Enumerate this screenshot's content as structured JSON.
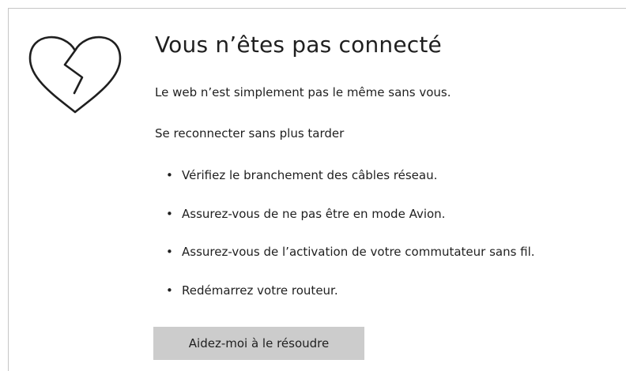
{
  "page": {
    "title": "Vous n’êtes pas connecté",
    "subtitle": "Le web n’est simplement pas le même sans vous.",
    "section_heading": "Se reconnecter sans plus tarder",
    "bullet_glyph": "•",
    "tips": [
      "Vérifiez le branchement des câbles réseau.",
      "Assurez-vous de ne pas être en mode Avion.",
      "Assurez-vous de l’activation de votre commutateur sans fil.",
      "Redémarrez votre routeur."
    ],
    "fix_button_label": "Aidez-moi à le résoudre"
  },
  "icons": {
    "status_icon": "broken-heart-icon"
  },
  "colors": {
    "text": "#1f1f1f",
    "button_bg": "#cccccc",
    "frame_border": "#c6c6c6",
    "background": "#ffffff"
  }
}
